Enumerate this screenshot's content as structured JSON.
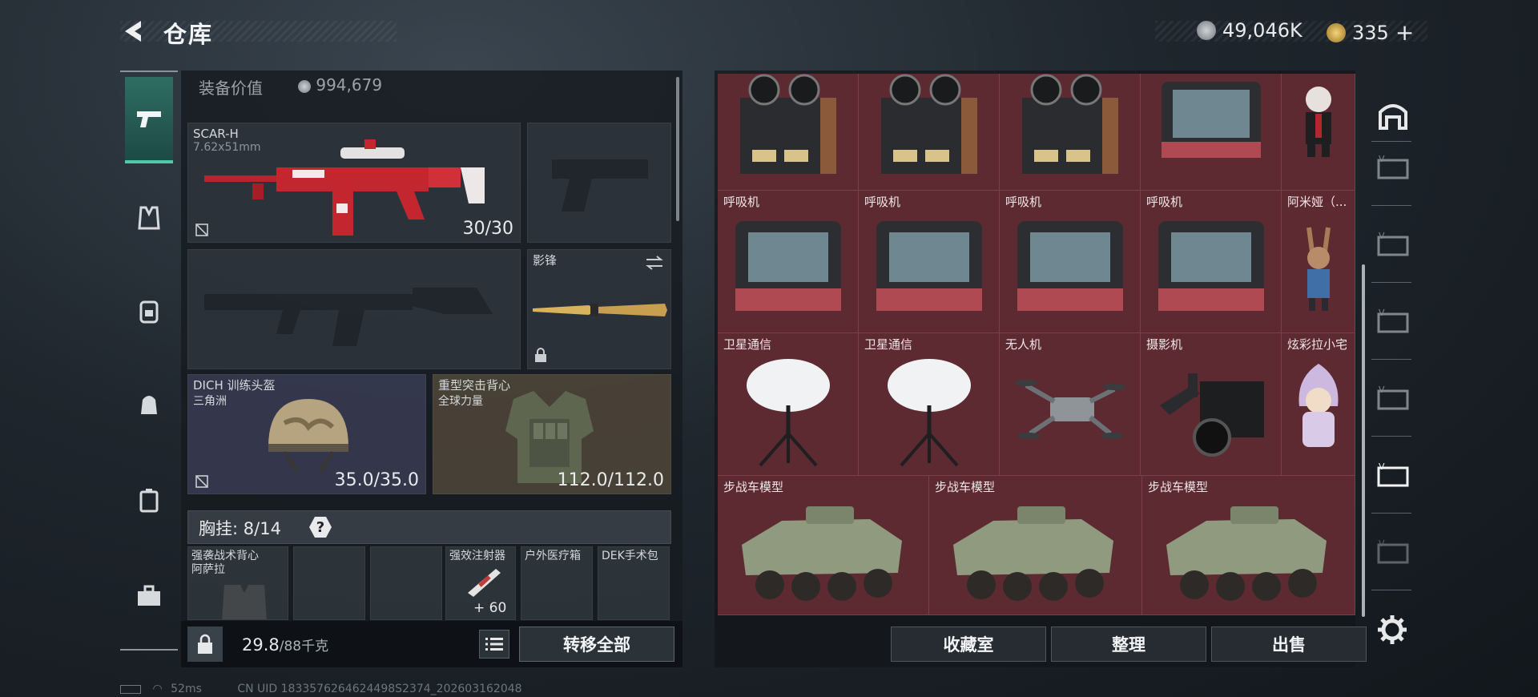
{
  "header": {
    "title": "仓库",
    "currency_silver": "49,046K",
    "currency_gold": "335",
    "add_label": "+"
  },
  "equipment": {
    "value_label": "装备价值",
    "value": "994,679",
    "primary_weapon": {
      "name": "SCAR-H",
      "caliber": "7.62x51mm",
      "ammo": "30/30"
    },
    "melee": {
      "name": "影锋"
    },
    "helmet": {
      "name": "DICH 训练头盔",
      "sub": "三角洲",
      "durability": "35.0/35.0"
    },
    "armor": {
      "name": "重型突击背心",
      "sub": "全球力量",
      "durability": "112.0/112.0"
    },
    "chest_rig": {
      "label": "胸挂:",
      "capacity": "8/14",
      "help": "?"
    },
    "rig_items": [
      {
        "name": "强袭战术背心",
        "sub": "阿萨拉"
      },
      {
        "name": ""
      },
      {
        "name": ""
      },
      {
        "name": "强效注射器",
        "count": "60"
      },
      {
        "name": "户外医疗箱"
      },
      {
        "name": "DEK手术包"
      }
    ]
  },
  "bottom_bar": {
    "weight": "29.8",
    "weight_max": "/88千克",
    "transfer_label": "转移全部"
  },
  "storage": {
    "rows": [
      [
        "",
        "",
        "",
        "",
        ""
      ],
      [
        "呼吸机",
        "呼吸机",
        "呼吸机",
        "呼吸机",
        "阿米娅（..."
      ],
      [
        "卫星通信",
        "卫星通信",
        "无人机",
        "摄影机",
        "炫彩拉小宅"
      ],
      [
        "步战车模型",
        "步战车模型",
        "步战车模型"
      ]
    ],
    "buttons": {
      "collection": "收藏室",
      "sort": "整理",
      "sell": "出售"
    }
  },
  "status": {
    "ping": "52ms",
    "uid": "CN UID 1833576264624498S2374_202603162048"
  },
  "colors": {
    "accent": "#4fc9a8",
    "grid_bg": "#5d2a31"
  }
}
